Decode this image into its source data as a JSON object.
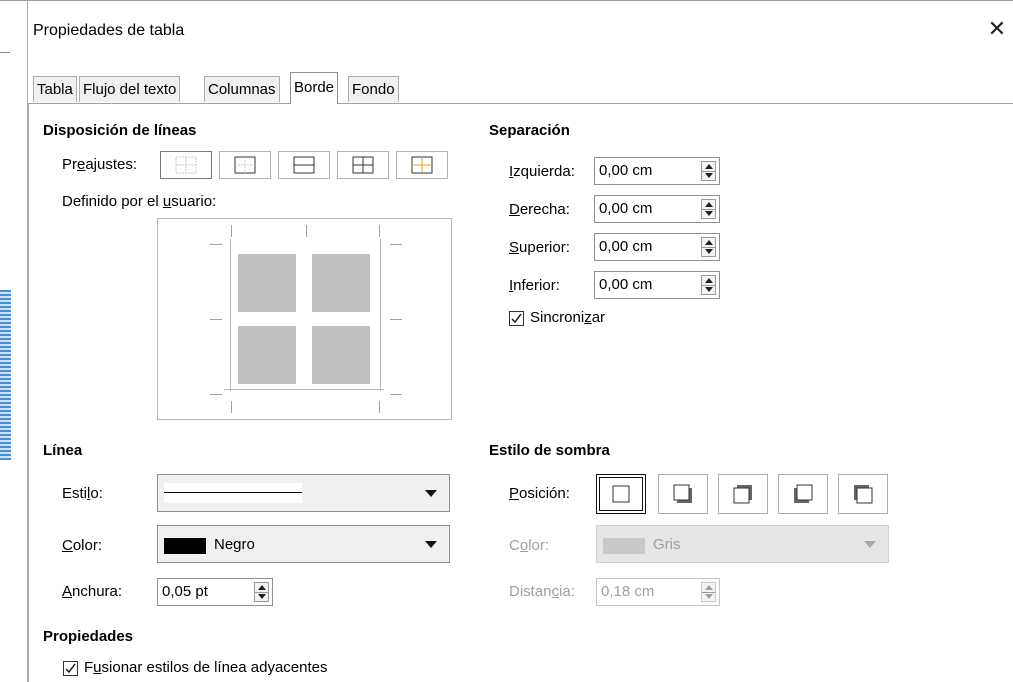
{
  "dialog": {
    "title": "Propiedades de tabla",
    "close": "✕"
  },
  "tabs": [
    {
      "label": "Tabla"
    },
    {
      "label": "Flujo del texto"
    },
    {
      "label": "Columnas"
    },
    {
      "label": "Borde",
      "active": true
    },
    {
      "label": "Fondo"
    }
  ],
  "disposicion": {
    "heading": "Disposición de líneas",
    "preajustes_label_pre": "Pr",
    "preajustes_label_u": "e",
    "preajustes_label_post": "ajustes:",
    "presets_icons": [
      "no-borders-icon",
      "outer-border-icon",
      "outer-horizontal-icon",
      "all-borders-icon",
      "outer-inner-horizontal-icon"
    ],
    "usuario_label_pre": "Definido por el ",
    "usuario_label_u": "u",
    "usuario_label_post": "suario:"
  },
  "separacion": {
    "heading": "Separación",
    "izquierda": {
      "u": "I",
      "rest": "zquierda:",
      "value": "0,00 cm"
    },
    "derecha": {
      "u": "D",
      "rest": "erecha:",
      "value": "0,00 cm"
    },
    "superior": {
      "u": "S",
      "rest": "uperior:",
      "value": "0,00 cm"
    },
    "inferior": {
      "u": "I",
      "rest": "nferior:",
      "value": "0,00 cm"
    },
    "sincronizar": {
      "pre": "Sincroni",
      "u": "z",
      "post": "ar",
      "checked": true
    }
  },
  "linea": {
    "heading": "Línea",
    "estilo": {
      "pre": "Esti",
      "u": "l",
      "post": "o:"
    },
    "color": {
      "u": "C",
      "rest": "olor:",
      "value": "Negro",
      "swatch": "#000000"
    },
    "anchura": {
      "u": "A",
      "rest": "nchura:",
      "value": "0,05 pt"
    }
  },
  "sombra": {
    "heading": "Estilo de sombra",
    "posicion": {
      "u": "P",
      "rest": "osición:"
    },
    "positions_icons": [
      "no-shadow-icon",
      "shadow-bottom-right-icon",
      "shadow-top-right-icon",
      "shadow-bottom-left-icon",
      "shadow-top-left-icon"
    ],
    "color": {
      "pre": "C",
      "u": "o",
      "post": "lor:",
      "value": "Gris",
      "swatch": "#c0c0c0"
    },
    "distancia": {
      "pre": "Distan",
      "u": "c",
      "post": "ia:",
      "value": "0,18 cm"
    }
  },
  "propiedades": {
    "heading": "Propiedades",
    "fusionar": {
      "pre": "F",
      "u": "u",
      "post": "sionar estilos de línea adyacentes",
      "checked": true
    }
  }
}
